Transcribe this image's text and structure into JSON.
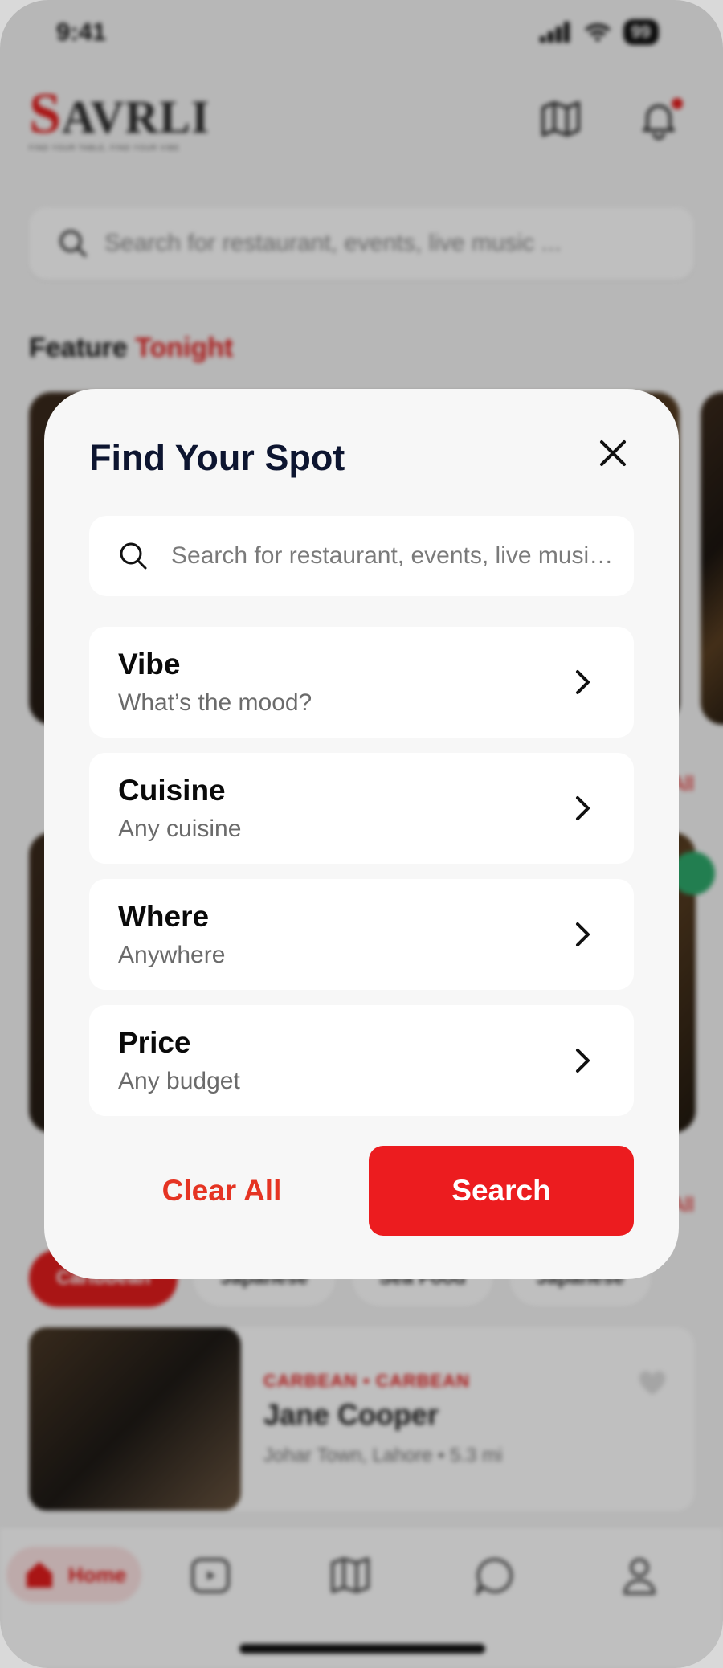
{
  "status_bar": {
    "time": "9:41",
    "battery": "99"
  },
  "brand": {
    "logo_first": "S",
    "logo_rest": "AVRLI",
    "tagline": "FIND YOUR TABLE, FIND YOUR VIBE"
  },
  "background": {
    "search_placeholder": "Search for restaurant, events, live music ...",
    "feature_title_part1": "Feature",
    "feature_title_part2": "Tonight",
    "chips": [
      "Caribbean",
      "Japanese",
      "Sea Food",
      "Japanese"
    ],
    "listing": {
      "category": "CARBEAN • CARBEAN",
      "name": "Jane Cooper",
      "location": "Johar Town, Lahore  • 5.3 mi"
    },
    "tabbar": {
      "home_label": "Home"
    }
  },
  "modal": {
    "title": "Find Your Spot",
    "search_placeholder": "Search for restaurant, events, live music ...",
    "filters": [
      {
        "label": "Vibe",
        "value": "What’s the mood?"
      },
      {
        "label": "Cuisine",
        "value": "Any cuisine"
      },
      {
        "label": "Where",
        "value": "Anywhere"
      },
      {
        "label": "Price",
        "value": "Any budget"
      }
    ],
    "clear_label": "Clear All",
    "search_label": "Search"
  },
  "colors": {
    "accent": "#EC1C1F",
    "title": "#0D1530",
    "clear": "#E53423"
  }
}
